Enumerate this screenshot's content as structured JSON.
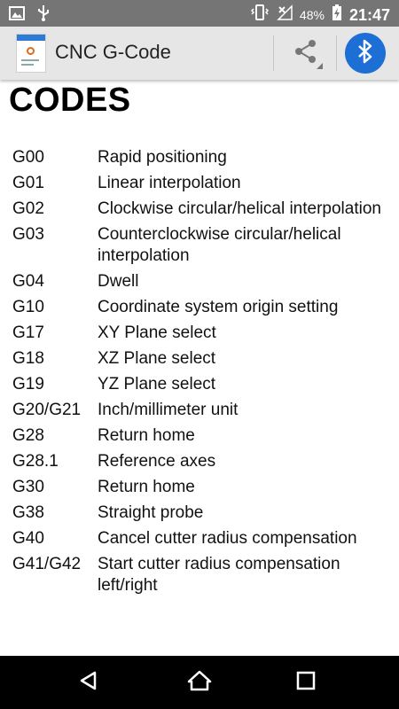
{
  "status_bar": {
    "battery_percent": "48%",
    "time": "21:47"
  },
  "app_bar": {
    "title": "CNC G-Code"
  },
  "content": {
    "heading": "CODES",
    "codes": [
      {
        "code": "G00",
        "desc": "Rapid positioning"
      },
      {
        "code": "G01",
        "desc": "Linear interpolation"
      },
      {
        "code": "G02",
        "desc": "Clockwise circular/helical interpolation"
      },
      {
        "code": "G03",
        "desc": "Counterclockwise circular/helical interpolation"
      },
      {
        "code": "G04",
        "desc": "Dwell"
      },
      {
        "code": "G10",
        "desc": "Coordinate system origin setting"
      },
      {
        "code": "G17",
        "desc": "XY Plane select"
      },
      {
        "code": "G18",
        "desc": "XZ Plane select"
      },
      {
        "code": "G19",
        "desc": "YZ Plane select"
      },
      {
        "code": "G20/G21",
        "desc": "Inch/millimeter unit"
      },
      {
        "code": "G28",
        "desc": "Return home"
      },
      {
        "code": "G28.1",
        "desc": "Reference axes"
      },
      {
        "code": "G30",
        "desc": "Return home"
      },
      {
        "code": "G38",
        "desc": "Straight probe"
      },
      {
        "code": "G40",
        "desc": "Cancel cutter radius compensation"
      },
      {
        "code": "G41/G42",
        "desc": "Start cutter radius compensation left/right"
      }
    ]
  },
  "colors": {
    "status_bar": "#757575",
    "app_bar": "#e6e6e6",
    "bluetooth_button": "#1d6fd6",
    "nav_bar": "#000000"
  }
}
